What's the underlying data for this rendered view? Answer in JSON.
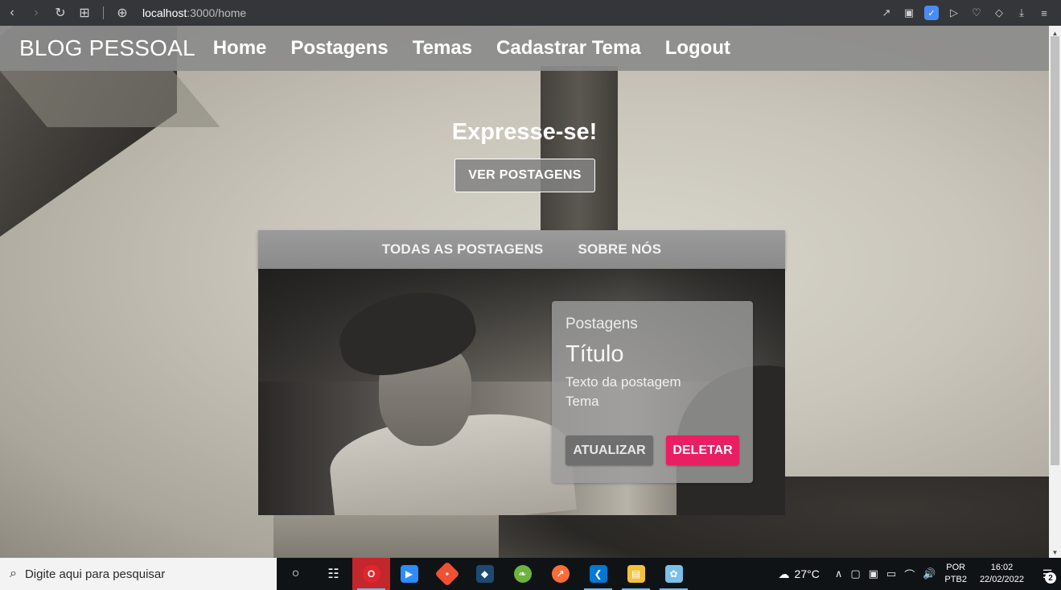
{
  "browser": {
    "url_host": "localhost",
    "url_path": ":3000/home",
    "icons": [
      "back-arrow-icon",
      "forward-arrow-icon",
      "reload-icon",
      "grid-icon",
      "globe-icon",
      "share-icon",
      "camera-icon",
      "brave-shield-icon",
      "send-icon",
      "heart-icon",
      "cube-icon",
      "download-icon",
      "menu-icon"
    ]
  },
  "navbar": {
    "brand": "BLOG PESSOAL",
    "links": [
      "Home",
      "Postagens",
      "Temas",
      "Cadastrar Tema",
      "Logout"
    ]
  },
  "hero": {
    "title": "Expresse-se!",
    "button": "VER POSTAGENS"
  },
  "tabs": [
    "TODAS AS POSTAGENS",
    "SOBRE NÓS"
  ],
  "post": {
    "subtitle": "Postagens",
    "title": "Título",
    "text": "Texto da postagem",
    "theme": "Tema",
    "update_label": "ATUALIZAR",
    "delete_label": "DELETAR"
  },
  "taskbar": {
    "search_placeholder": "Digite aqui para pesquisar",
    "temperature": "27°C",
    "lang1": "POR",
    "lang2": "PTB2",
    "time": "16:02",
    "date": "22/02/2022",
    "notification_count": "2"
  },
  "colors": {
    "accent_delete": "#e91e63",
    "navbar_bg": "#8c8c8c"
  }
}
